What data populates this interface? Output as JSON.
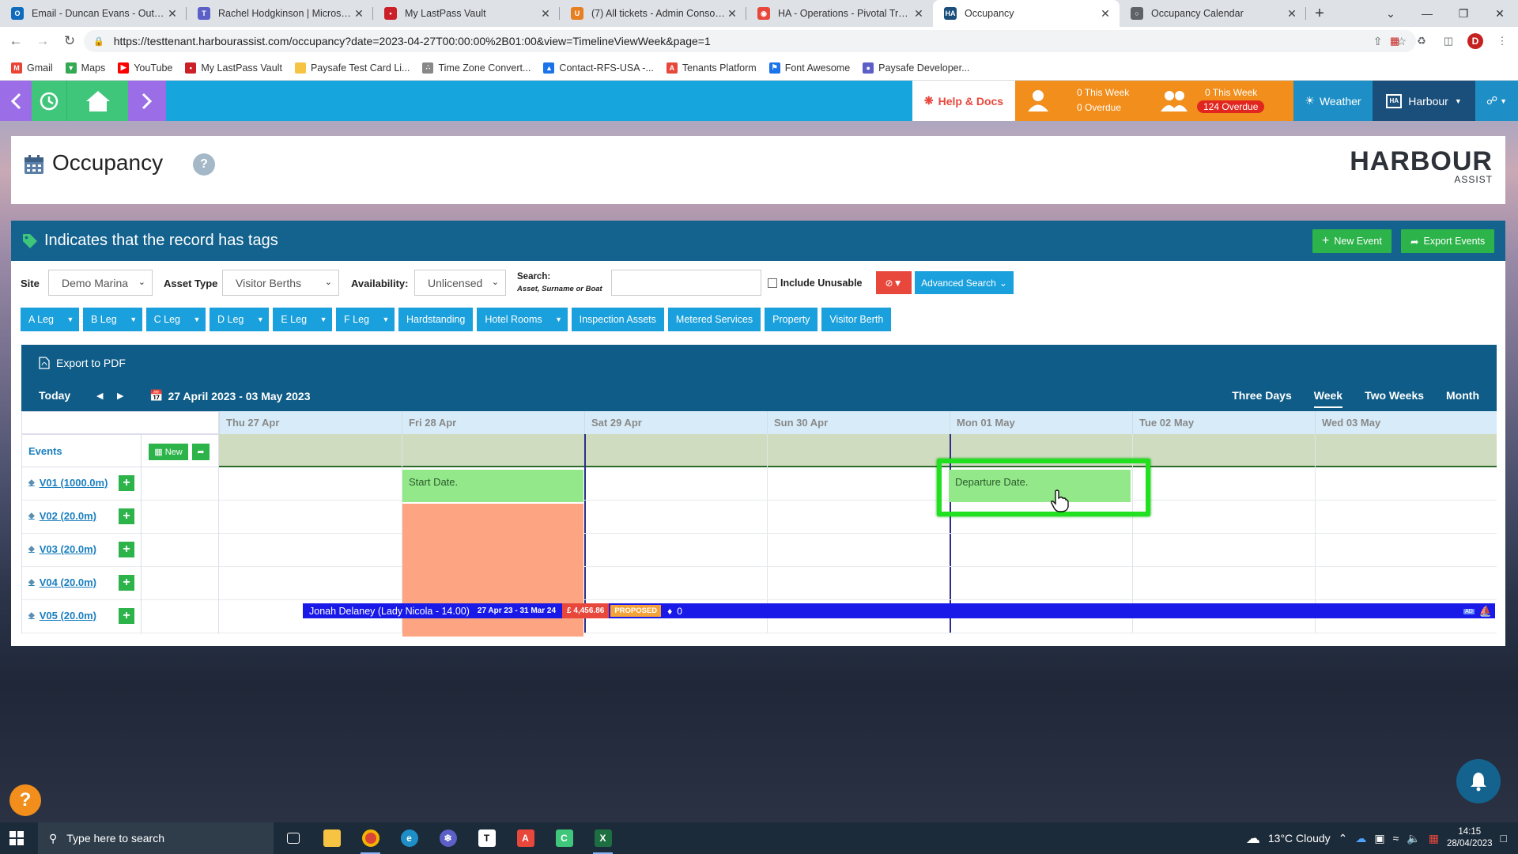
{
  "browser": {
    "tabs": [
      {
        "title": "Email - Duncan Evans - Outlook",
        "fav_color": "#0f6cbd",
        "fav": "O",
        "icon": "outlook-icon"
      },
      {
        "title": "Rachel Hodgkinson | Microsoft T",
        "fav_color": "#5b5fc7",
        "fav": "T",
        "icon": "teams-icon"
      },
      {
        "title": "My LastPass Vault",
        "fav_color": "#cc2029",
        "fav": "•",
        "icon": "lastpass-icon"
      },
      {
        "title": "(7) All tickets - Admin Console (",
        "fav_color": "#e67e22",
        "fav": "U",
        "icon": "freshdesk-icon"
      },
      {
        "title": "HA - Operations - Pivotal Tracke",
        "fav_color": "#e8473c",
        "fav": "◉",
        "icon": "pivotal-icon"
      },
      {
        "title": "Occupancy",
        "fav_color": "#1a4f7c",
        "fav": "HA",
        "icon": "harbour-assist-icon"
      },
      {
        "title": "Occupancy Calendar",
        "fav_color": "#5f6368",
        "fav": "○",
        "icon": "globe-icon"
      }
    ],
    "url": "https://testtenant.harbourassist.com/occupancy?date=2023-04-27T00:00:00%2B01:00&view=TimelineViewWeek&page=1",
    "avatar": "D",
    "bookmarks": [
      {
        "label": "Gmail",
        "color": "#ea4335",
        "glyph": "M",
        "icon": "gmail-icon"
      },
      {
        "label": "Maps",
        "color": "#34a853",
        "glyph": "▼",
        "icon": "maps-icon"
      },
      {
        "label": "YouTube",
        "color": "#ff0000",
        "glyph": "▶",
        "icon": "youtube-icon"
      },
      {
        "label": "My LastPass Vault",
        "color": "#cc2029",
        "glyph": "•",
        "icon": "lastpass-icon"
      },
      {
        "label": "Paysafe Test Card Li...",
        "color": "#f6c342",
        "glyph": "",
        "icon": "folder-icon"
      },
      {
        "label": "Time Zone Convert...",
        "color": "#888888",
        "glyph": "∴",
        "icon": "timezone-icon"
      },
      {
        "label": "Contact-RFS-USA -...",
        "color": "#1a73e8",
        "glyph": "▲",
        "icon": "contact-icon"
      },
      {
        "label": "Tenants Platform",
        "color": "#e8473c",
        "glyph": "A",
        "icon": "angular-icon"
      },
      {
        "label": "Font Awesome",
        "color": "#1a73e8",
        "glyph": "⚑",
        "icon": "flag-icon"
      },
      {
        "label": "Paysafe Developer...",
        "color": "#5b5fc7",
        "glyph": "●",
        "icon": "paysafe-icon"
      }
    ]
  },
  "appbar": {
    "help_docs": "Help & Docs",
    "my_tasks": {
      "week": "0 This Week",
      "overdue": "0 Overdue"
    },
    "team_tasks": {
      "week": "0 This Week",
      "overdue": "124 Overdue"
    },
    "weather": "Weather",
    "harbour": "Harbour"
  },
  "page": {
    "title": "Occupancy",
    "help": "?",
    "logo_big": "HARBOUR",
    "logo_small": "ASSIST"
  },
  "tagbar": {
    "message": "Indicates that the record has tags",
    "new_event": "New Event",
    "export_events": "Export Events"
  },
  "filters": {
    "site_label": "Site",
    "site_value": "Demo Marina",
    "asset_type_label": "Asset Type",
    "asset_type_value": "Visitor Berths",
    "availability_label": "Availability:",
    "availability_value": "Unlicensed",
    "search_label": "Search:",
    "search_sub": "Asset, Surname or Boat",
    "search_value": "",
    "include_unusable": "Include Unusable",
    "advanced_search": "Advanced Search"
  },
  "asset_buttons": [
    {
      "label": "A Leg",
      "dropdown": true
    },
    {
      "label": "B Leg",
      "dropdown": true
    },
    {
      "label": "C Leg",
      "dropdown": true
    },
    {
      "label": "D Leg",
      "dropdown": true
    },
    {
      "label": "E Leg",
      "dropdown": true
    },
    {
      "label": "F Leg",
      "dropdown": true
    },
    {
      "label": "Hardstanding",
      "dropdown": false
    },
    {
      "label": "Hotel Rooms",
      "dropdown": true
    },
    {
      "label": "Inspection Assets",
      "dropdown": false
    },
    {
      "label": "Metered Services",
      "dropdown": false
    },
    {
      "label": "Property",
      "dropdown": false
    },
    {
      "label": "Visitor Berth",
      "dropdown": false
    }
  ],
  "timeline": {
    "export_pdf": "Export to PDF",
    "today": "Today",
    "range": "27 April 2023 - 03 May 2023",
    "views": [
      "Three Days",
      "Week",
      "Two Weeks",
      "Month"
    ],
    "selected_view": "Week",
    "days": [
      "Thu 27 Apr",
      "Fri 28 Apr",
      "Sat 29 Apr",
      "Sun 30 Apr",
      "Mon 01 May",
      "Tue 02 May",
      "Wed 03 May"
    ],
    "events_label": "Events",
    "new_label": "New",
    "resources": [
      "V01 (1000.0m)",
      "V02 (20.0m)",
      "V03 (20.0m)",
      "V04 (20.0m)",
      "V05 (20.0m)"
    ],
    "start_date": "Start Date.",
    "departure_date": "Departure Date.",
    "booking": {
      "name": "Jonah Delaney (Lady Nicola - 14.00)",
      "dates": "27 Apr 23 - 31 Mar 24",
      "price": "£ 4,456.86",
      "status": "PROPOSED",
      "tags": "0",
      "badge": "AD"
    }
  },
  "taskbar": {
    "search_placeholder": "Type here to search",
    "weather": "13°C  Cloudy",
    "time": "14:15",
    "date": "28/04/2023"
  }
}
